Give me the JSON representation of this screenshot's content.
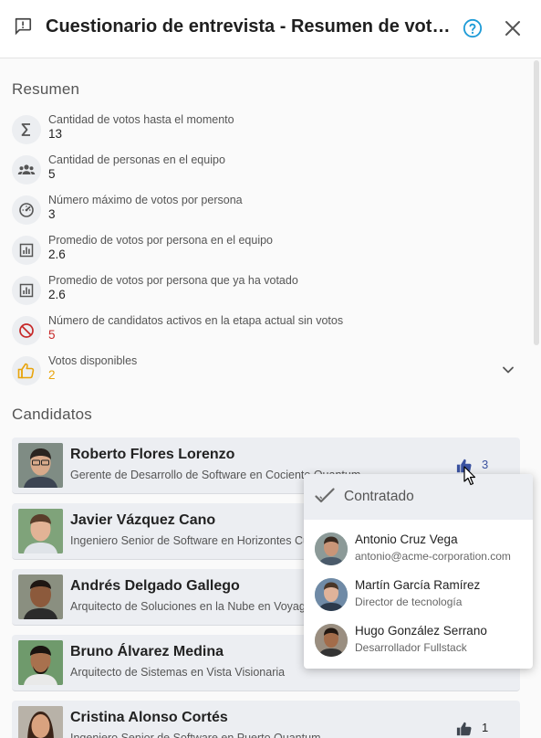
{
  "header": {
    "title": "Cuestionario de entrevista - Resumen de votación",
    "icons": {
      "left": "feedback-icon",
      "help": "help-circle-icon",
      "close": "close-icon"
    }
  },
  "summary": {
    "title": "Resumen",
    "stats": [
      {
        "label": "Cantidad de votos hasta el momento",
        "value": "13",
        "icon": "sigma-icon"
      },
      {
        "label": "Cantidad de personas en el equipo",
        "value": "5",
        "icon": "group-icon"
      },
      {
        "label": "Número máximo de votos por persona",
        "value": "3",
        "icon": "gauge-icon"
      },
      {
        "label": "Promedio de votos por persona en el equipo",
        "value": "2.6",
        "icon": "bar-chart-icon"
      },
      {
        "label": "Promedio de votos por persona que ya ha votado",
        "value": "2.6",
        "icon": "bar-chart-icon"
      },
      {
        "label": "Número de candidatos activos en la etapa actual sin votos",
        "value": "5",
        "icon": "no-votes-icon",
        "color": "#c62828"
      },
      {
        "label": "Votos disponibles",
        "value": "2",
        "icon": "thumb-up-icon",
        "color": "#e8a40c"
      }
    ]
  },
  "candidates": {
    "title": "Candidatos",
    "items": [
      {
        "name": "Roberto Flores Lorenzo",
        "role": "Gerente de Desarrollo de Software en Cociente Quantum",
        "votes": "3"
      },
      {
        "name": "Javier Vázquez Cano",
        "role": "Ingeniero Senior de Software en Horizontes Cuánticos",
        "votes": ""
      },
      {
        "name": "Andrés Delgado Gallego",
        "role": "Arquitecto de Soluciones en la Nube en Voyager",
        "votes": ""
      },
      {
        "name": "Bruno Álvarez Medina",
        "role": "Arquitecto de Sistemas en Vista Visionaria",
        "votes": ""
      },
      {
        "name": "Cristina Alonso Cortés",
        "role": "Ingeniero Senior de Software en Puerto Quantum",
        "votes": "1"
      }
    ]
  },
  "popover": {
    "title": "Contratado",
    "voters": [
      {
        "name": "Antonio Cruz Vega",
        "sub": "antonio@acme-corporation.com"
      },
      {
        "name": "Martín García Ramírez",
        "sub": "Director de tecnología"
      },
      {
        "name": "Hugo González Serrano",
        "sub": "Desarrollador Fullstack"
      }
    ]
  },
  "colors": {
    "accent": "#1e9bd7",
    "vote_blue": "#3a52a0",
    "warning": "#e8a40c",
    "danger": "#c62828"
  }
}
